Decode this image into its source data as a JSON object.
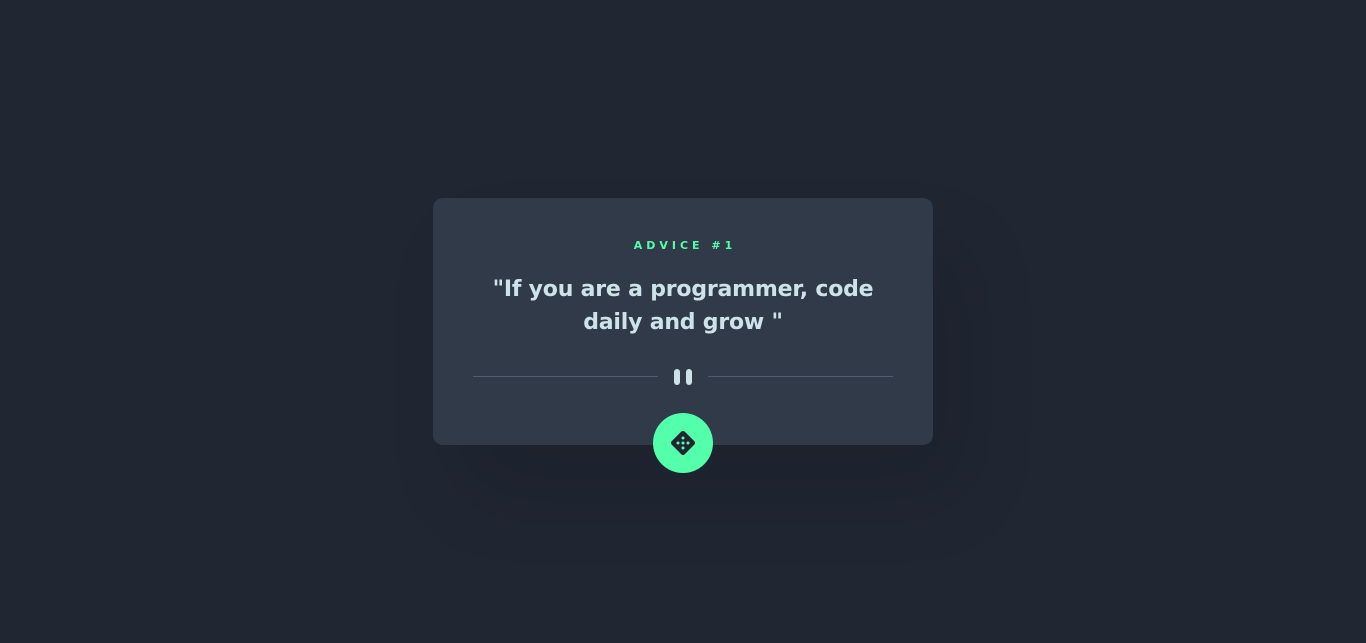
{
  "advice": {
    "id_label": "ADVICE #1",
    "quote": "\"If you are a programmer, code daily and grow \""
  },
  "icons": {
    "divider": "pause-icon",
    "generate": "dice-icon"
  },
  "colors": {
    "background": "#202632",
    "card": "#313a48",
    "accent": "#53ffab",
    "text": "#cee3e9",
    "divider": "#4f5d74"
  }
}
